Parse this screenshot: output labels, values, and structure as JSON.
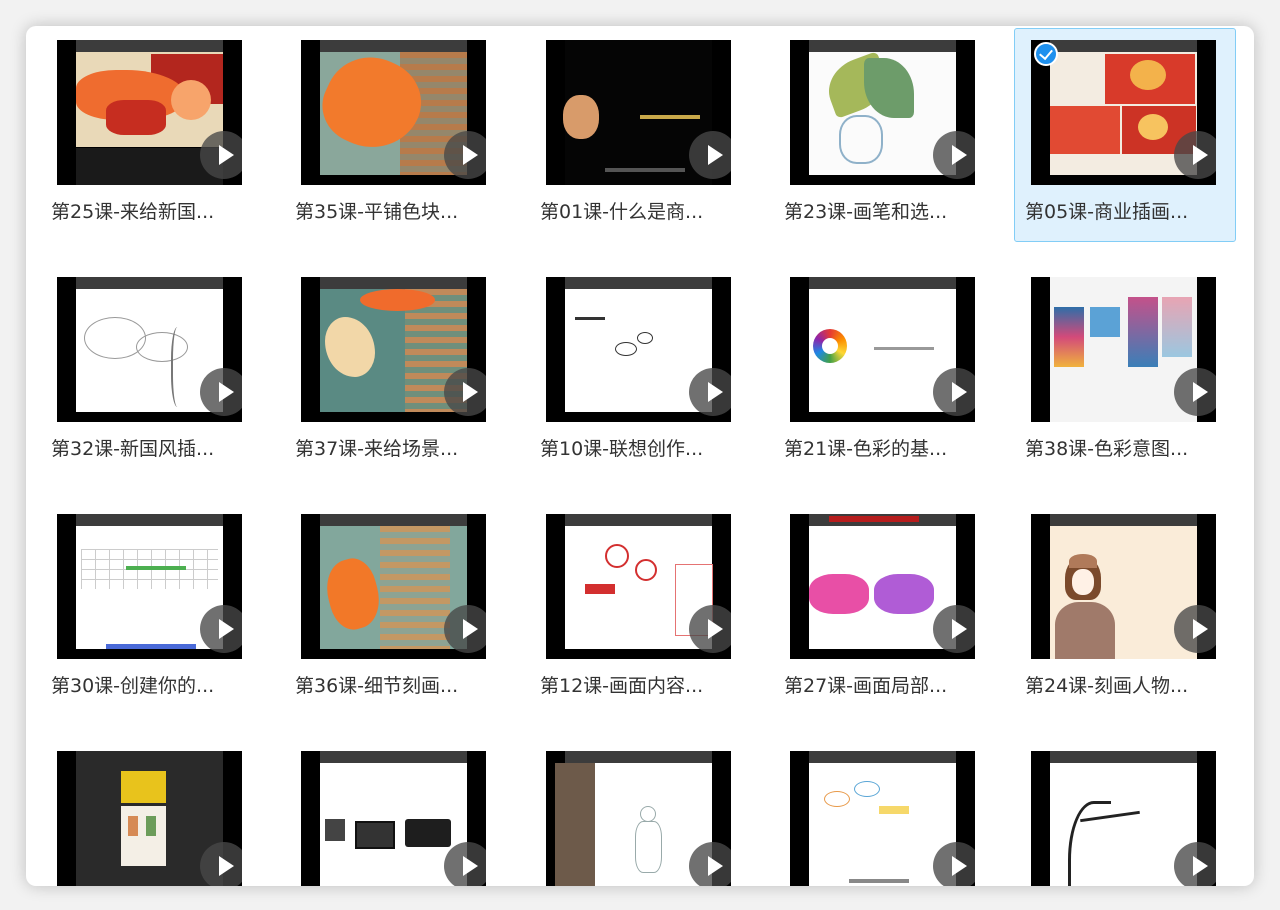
{
  "lessons": [
    {
      "label": "第25课-来给新国...",
      "thumb": "lion-dance-illustration",
      "selected": false
    },
    {
      "label": "第35课-平铺色块...",
      "thumb": "koi-fish-orange",
      "selected": false
    },
    {
      "label": "第01课-什么是商...",
      "thumb": "dark-title-slide",
      "selected": false
    },
    {
      "label": "第23课-画笔和选...",
      "thumb": "phoenix-sketch-green",
      "selected": false
    },
    {
      "label": "第05课-商业插画...",
      "thumb": "red-poster-collage",
      "selected": true
    },
    {
      "label": "第32课-新国风插...",
      "thumb": "line-sketch-clouds",
      "selected": false
    },
    {
      "label": "第37课-来给场景...",
      "thumb": "koi-teal-scene",
      "selected": false
    },
    {
      "label": "第10课-联想创作...",
      "thumb": "mind-map-small",
      "selected": false
    },
    {
      "label": "第21课-色彩的基...",
      "thumb": "color-wheel",
      "selected": false
    },
    {
      "label": "第38课-色彩意图...",
      "thumb": "color-palette-board",
      "selected": false
    },
    {
      "label": "第30课-创建你的...",
      "thumb": "schedule-table",
      "selected": false
    },
    {
      "label": "第36课-细节刻画...",
      "thumb": "koi-pagoda",
      "selected": false
    },
    {
      "label": "第12课-画面内容...",
      "thumb": "red-mind-map",
      "selected": false
    },
    {
      "label": "第27课-画面局部...",
      "thumb": "pink-lion-dance",
      "selected": false
    },
    {
      "label": "第24课-刻画人物...",
      "thumb": "girl-portrait",
      "selected": false
    },
    {
      "label": "",
      "thumb": "dark-photo-layout",
      "selected": false
    },
    {
      "label": "",
      "thumb": "drawing-tablets",
      "selected": false
    },
    {
      "label": "",
      "thumb": "figure-sketch",
      "selected": false
    },
    {
      "label": "",
      "thumb": "mind-map-colored",
      "selected": false
    },
    {
      "label": "",
      "thumb": "crane-line-drawing",
      "selected": false
    }
  ]
}
